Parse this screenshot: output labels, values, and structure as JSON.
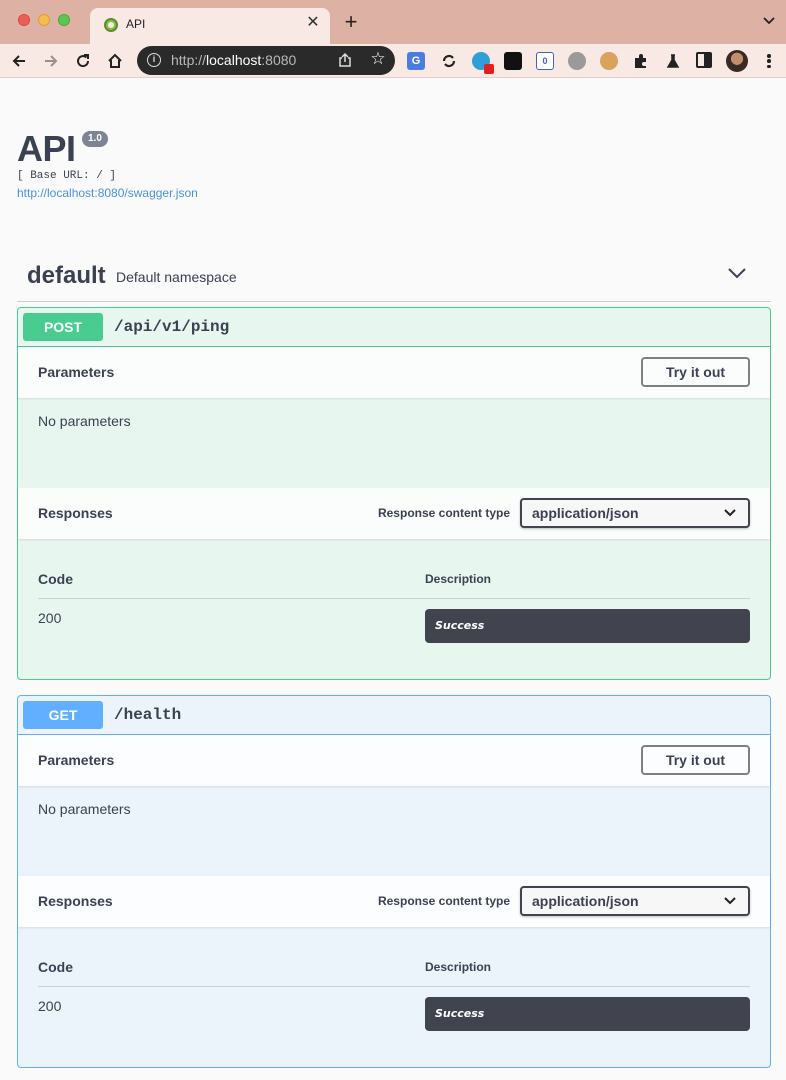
{
  "browser": {
    "tab_title": "API",
    "url_scheme": "http://",
    "url_host": "localhost",
    "url_port": ":8080",
    "colors": {
      "titlebar": "#ddb1a4",
      "toolbar": "#f8e9e4",
      "omnibox": "#2a2a2a"
    },
    "extensions": [
      "translate-icon",
      "sync-icon",
      "edge-icon",
      "clapper-icon",
      "badge-icon",
      "camera-icon",
      "cookie-icon",
      "puzzle-icon",
      "flask-icon"
    ]
  },
  "api": {
    "title": "API",
    "version": "1.0",
    "base_url": "[ Base URL: / ]",
    "spec_link": "http://localhost:8080/swagger.json"
  },
  "tag": {
    "name": "default",
    "description": "Default namespace"
  },
  "operations": [
    {
      "method": "POST",
      "path": "/api/v1/ping",
      "color": "#49cc90",
      "parameters_title": "Parameters",
      "try_button": "Try it out",
      "no_parameters": "No parameters",
      "responses_title": "Responses",
      "content_type_label": "Response content type",
      "content_type_value": "application/json",
      "col_code": "Code",
      "col_description": "Description",
      "responses": [
        {
          "code": "200",
          "description": "Success"
        }
      ]
    },
    {
      "method": "GET",
      "path": "/health",
      "color": "#61affe",
      "parameters_title": "Parameters",
      "try_button": "Try it out",
      "no_parameters": "No parameters",
      "responses_title": "Responses",
      "content_type_label": "Response content type",
      "content_type_value": "application/json",
      "col_code": "Code",
      "col_description": "Description",
      "responses": [
        {
          "code": "200",
          "description": "Success"
        }
      ]
    }
  ]
}
